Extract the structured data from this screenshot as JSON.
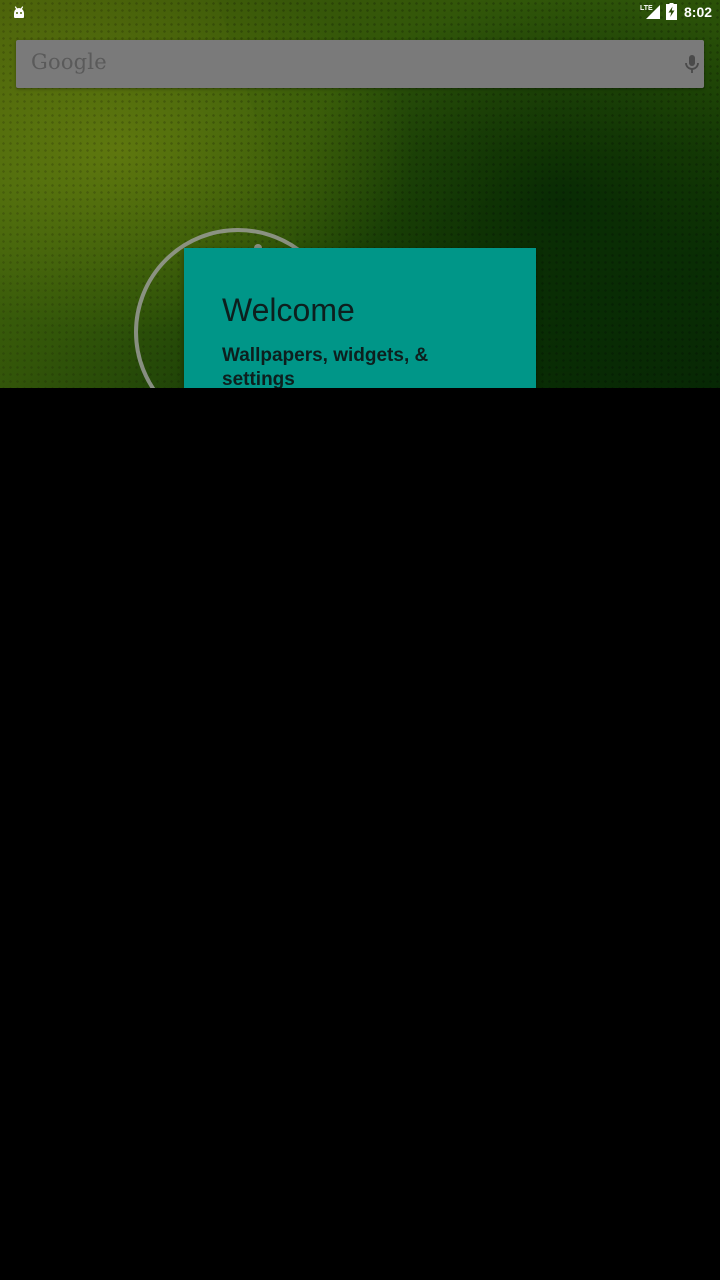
{
  "status_bar": {
    "time": "8:02",
    "network_label": "LTE",
    "notification_icon": "android-icon",
    "signal_icon": "signal-icon",
    "battery_icon": "battery-charging-icon"
  },
  "search": {
    "logo_text": "Google",
    "mic_icon": "mic-icon"
  },
  "onboarding": {
    "title": "Welcome",
    "subtitle": "Wallpapers, widgets, & settings"
  },
  "colors": {
    "card": "#009688",
    "search_bar": "#7a7a7a",
    "wallpaper_primary": "#3d6b0c",
    "overlay": "#000000"
  }
}
